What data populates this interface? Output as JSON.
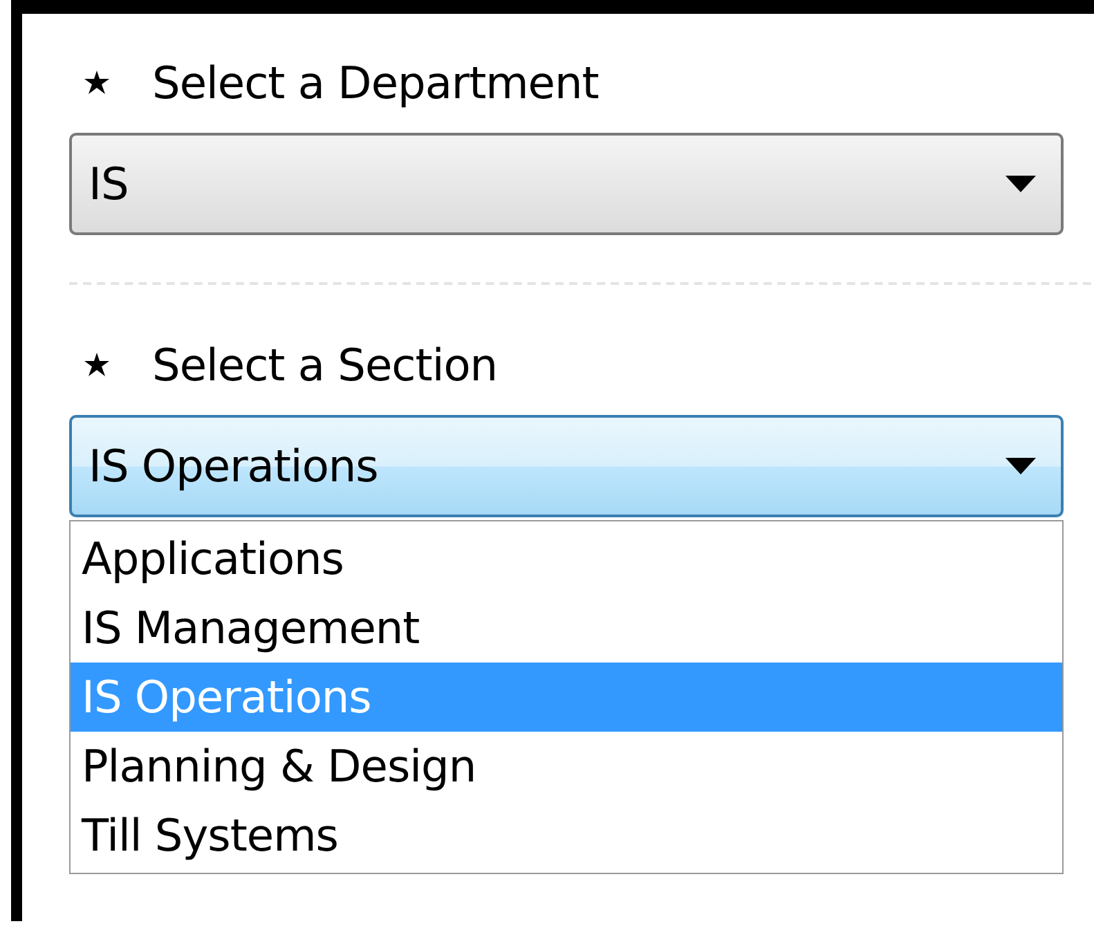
{
  "fields": [
    {
      "label": "Select a Department",
      "required": true,
      "value": "IS",
      "focused": false
    },
    {
      "label": "Select a Section",
      "required": true,
      "value": "IS Operations",
      "focused": true
    }
  ],
  "dropdown": {
    "options": [
      {
        "label": "Applications",
        "selected": false
      },
      {
        "label": "IS Management",
        "selected": false
      },
      {
        "label": "IS Operations",
        "selected": true
      },
      {
        "label": "Planning & Design",
        "selected": false
      },
      {
        "label": "Till Systems",
        "selected": false
      }
    ]
  }
}
